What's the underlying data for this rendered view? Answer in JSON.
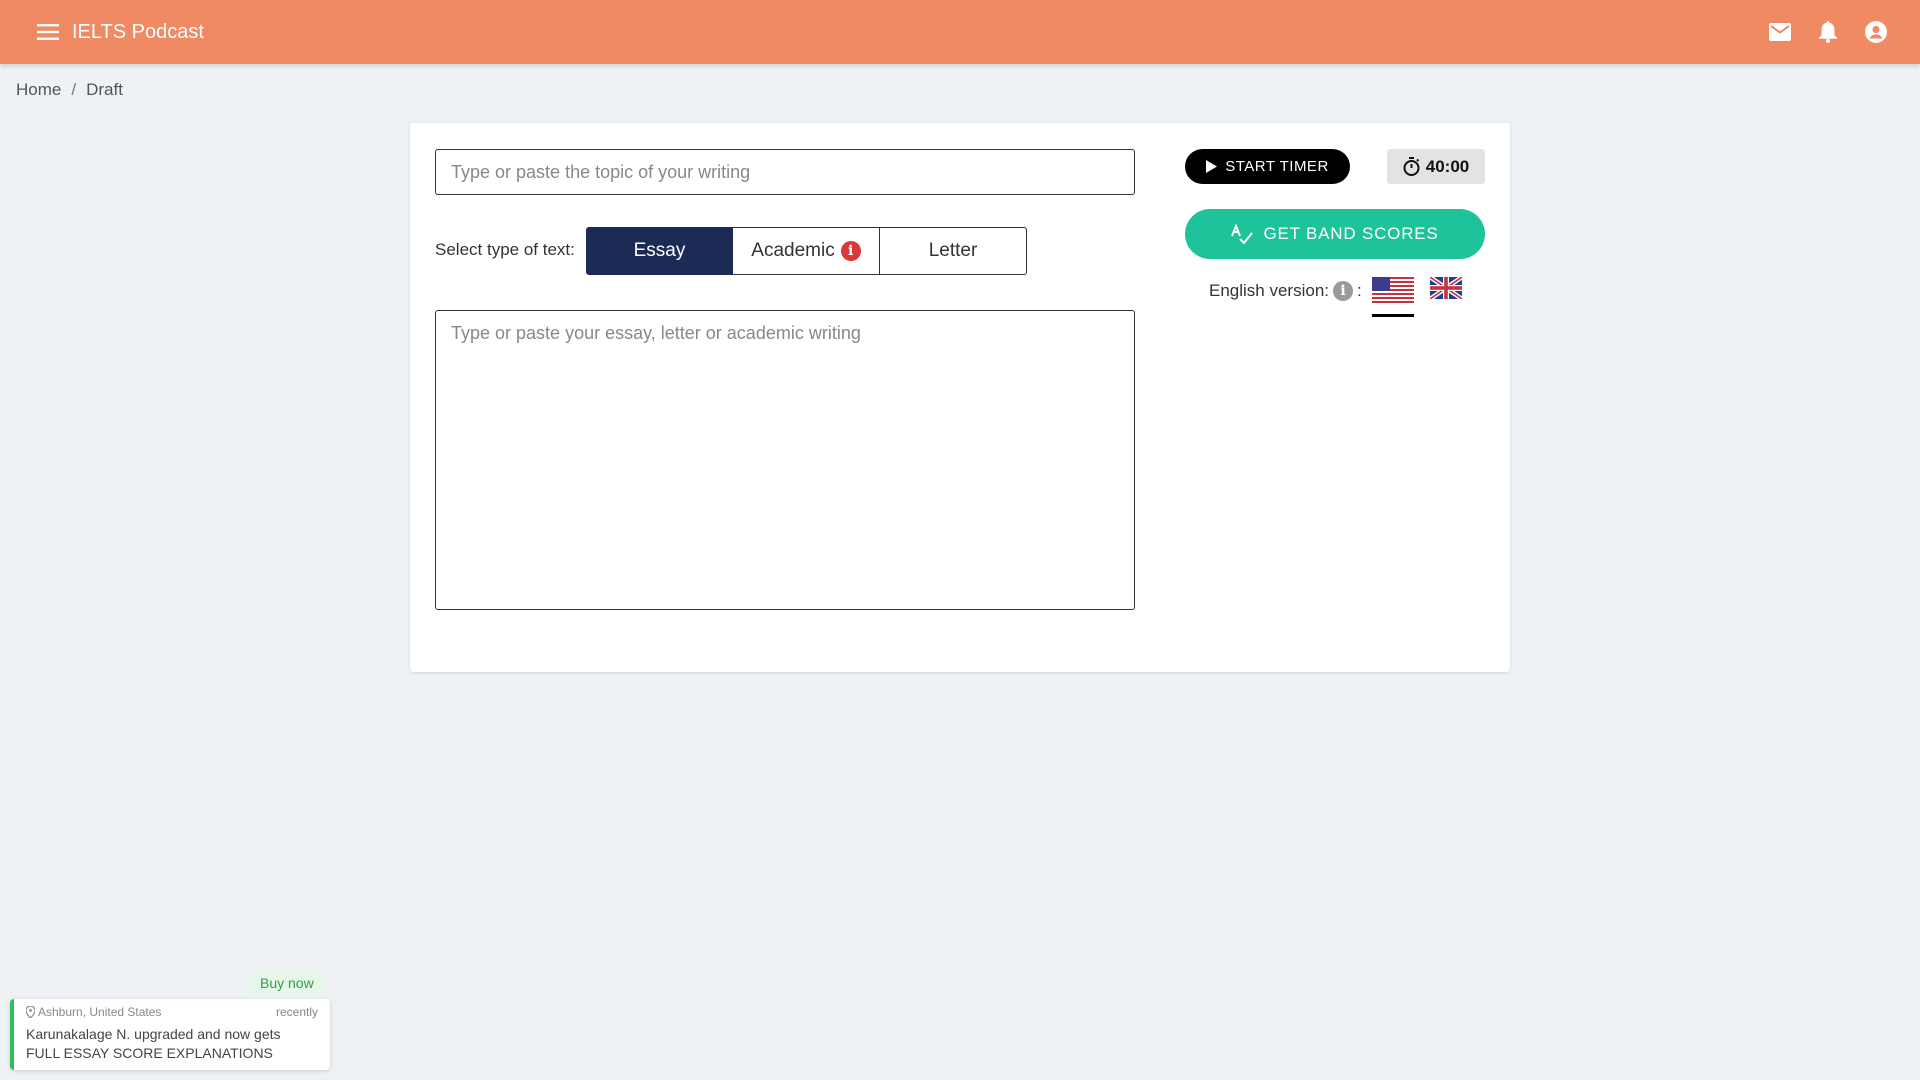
{
  "header": {
    "app_title": "IELTS Podcast",
    "bg_color": "#f08a63"
  },
  "breadcrumb": {
    "items": [
      "Home",
      "Draft"
    ],
    "separator": "/"
  },
  "editor": {
    "topic_placeholder": "Type or paste the topic of your writing",
    "topic_value": "",
    "type_label": "Select type of text:",
    "types": [
      {
        "label": "Essay",
        "selected": true
      },
      {
        "label": "Academic",
        "selected": false
      },
      {
        "label": "Letter",
        "selected": false
      }
    ],
    "essay_placeholder": "Type or paste your essay, letter or academic writing",
    "essay_value": ""
  },
  "sidebar": {
    "start_timer_label": "START TIMER",
    "timer_value": "40:00",
    "band_scores_label": "GET BAND SCORES",
    "english_version_label": "English version:",
    "english_version_suffix": ":",
    "selected_version": "US",
    "accent_color": "#1ec39a"
  },
  "notification": {
    "buy_now": "Buy now",
    "location": "Ashburn, United States",
    "time": "recently",
    "message": "Karunakalage N. upgraded and now gets FULL ESSAY SCORE EXPLANATIONS"
  }
}
